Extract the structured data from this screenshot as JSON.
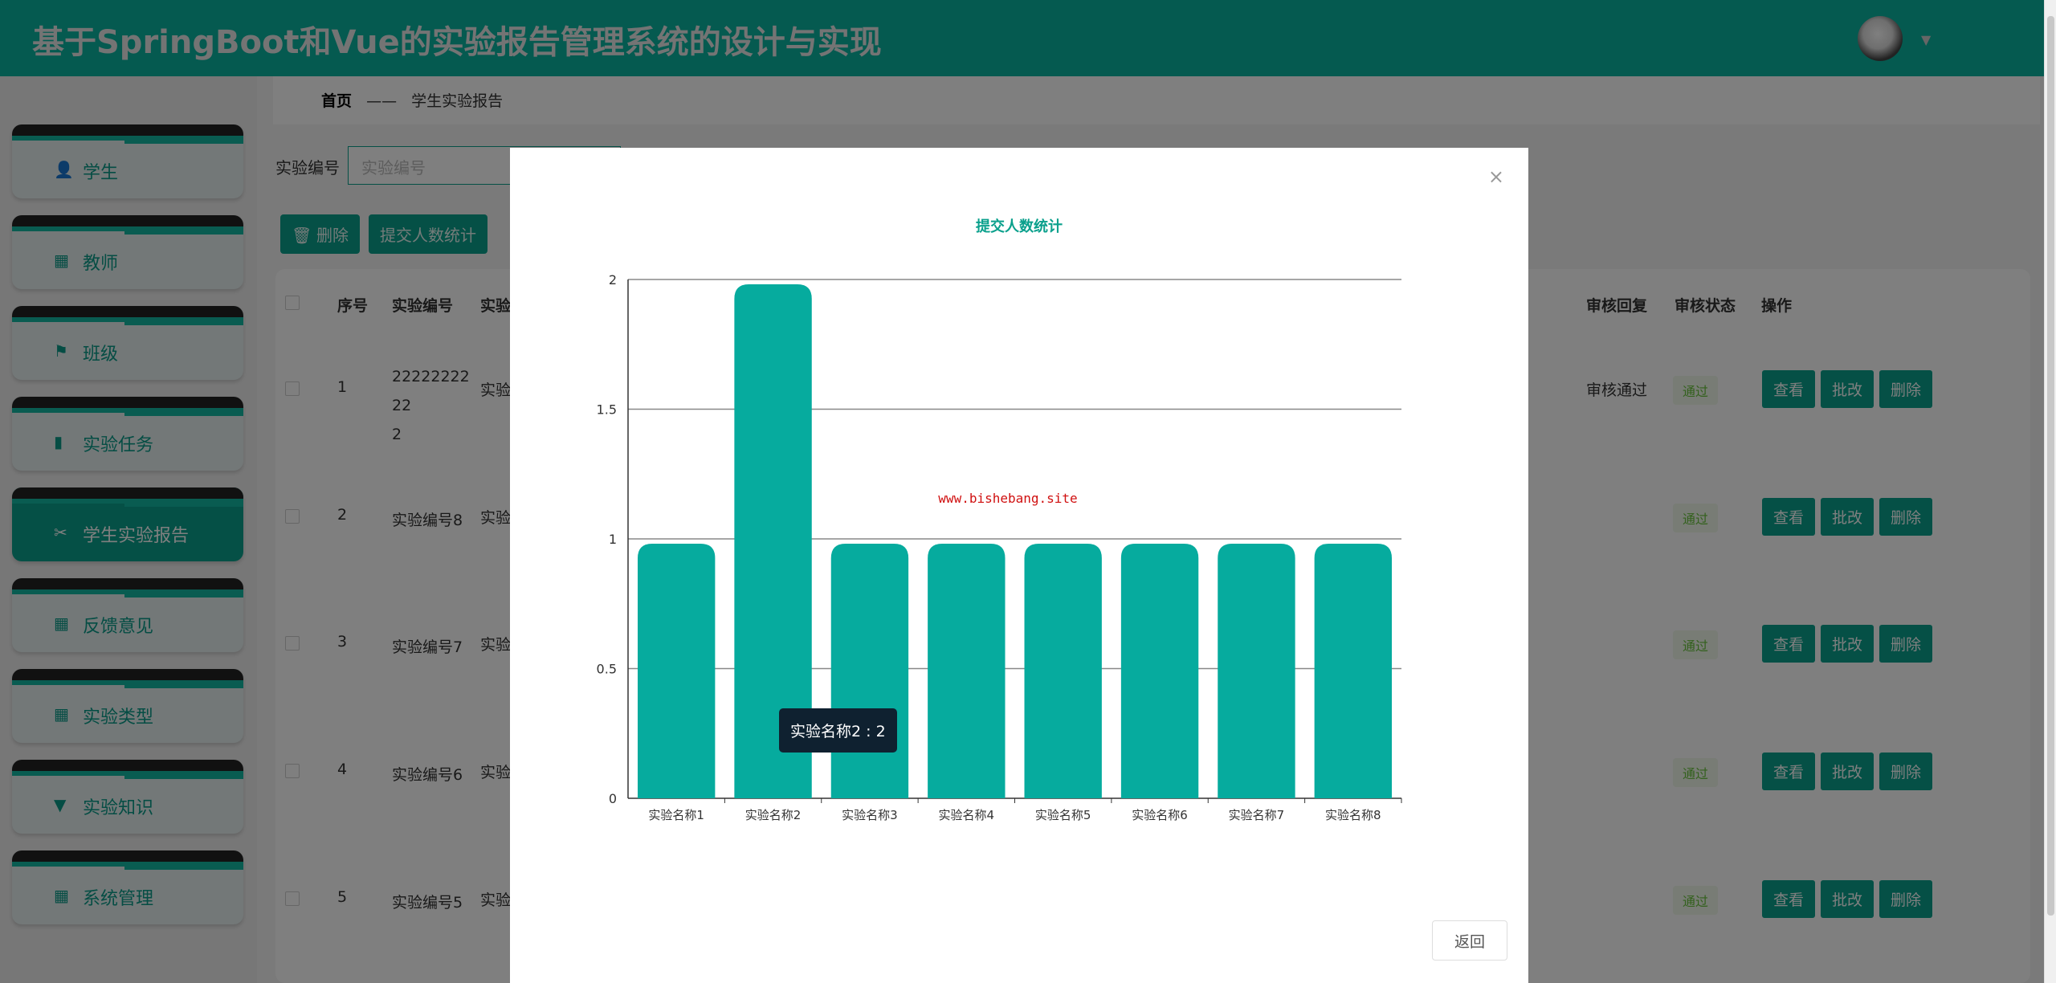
{
  "header": {
    "title": "基于SpringBoot和Vue的实验报告管理系统的设计与实现"
  },
  "sidebar": {
    "items": [
      {
        "label": "学生",
        "icon": "user-icon",
        "glyph": "👤"
      },
      {
        "label": "教师",
        "icon": "grid-icon",
        "glyph": "▦"
      },
      {
        "label": "班级",
        "icon": "flag-icon",
        "glyph": "⚑"
      },
      {
        "label": "实验任务",
        "icon": "bar-chart-icon",
        "glyph": "▮"
      },
      {
        "label": "学生实验报告",
        "icon": "ticket-icon",
        "glyph": "✂"
      },
      {
        "label": "反馈意见",
        "icon": "grid-icon",
        "glyph": "▦"
      },
      {
        "label": "实验类型",
        "icon": "apps-icon",
        "glyph": "▦"
      },
      {
        "label": "实验知识",
        "icon": "trophy-icon",
        "glyph": "▼"
      },
      {
        "label": "系统管理",
        "icon": "grid-icon",
        "glyph": "▦"
      }
    ]
  },
  "breadcrumb": {
    "home": "首页",
    "sep": "——",
    "current": "学生实验报告"
  },
  "search": {
    "label": "实验编号",
    "placeholder": "实验编号"
  },
  "toolbar": {
    "delete": "🗑 删除",
    "stats": "提交人数统计"
  },
  "table": {
    "headers": {
      "index": "序号",
      "code": "实验编号",
      "name": "实验",
      "reply": "审核回复",
      "status": "审核状态",
      "ops": "操作"
    },
    "rows": [
      {
        "index": "1",
        "code": "2222222222",
        "code2": "2",
        "name": "实验",
        "reply": "审核通过",
        "status": "通过"
      },
      {
        "index": "2",
        "code": "实验编号8",
        "name": "实验",
        "reply": "",
        "status": "通过"
      },
      {
        "index": "3",
        "code": "实验编号7",
        "name": "实验",
        "reply": "",
        "status": "通过"
      },
      {
        "index": "4",
        "code": "实验编号6",
        "name": "实验",
        "reply": "",
        "status": "通过"
      },
      {
        "index": "5",
        "code": "实验编号5",
        "name": "实验",
        "reply": "",
        "status": "通过"
      }
    ],
    "actions": {
      "view": "查看",
      "grade": "批改",
      "delete": "删除"
    }
  },
  "modal": {
    "close": "×",
    "back": "返回",
    "watermark": "www.bishebang.site",
    "tooltip": "实验名称2 : 2"
  },
  "chart_data": {
    "type": "bar",
    "title": "提交人数统计",
    "categories": [
      "实验名称1",
      "实验名称2",
      "实验名称3",
      "实验名称4",
      "实验名称5",
      "实验名称6",
      "实验名称7",
      "实验名称8"
    ],
    "values": [
      1,
      2,
      1,
      1,
      1,
      1,
      1,
      1
    ],
    "ylim": [
      0,
      2
    ],
    "yticks": [
      "0",
      "0.5",
      "1",
      "1.5",
      "2"
    ],
    "color": "#06ab9e",
    "grid": true
  }
}
